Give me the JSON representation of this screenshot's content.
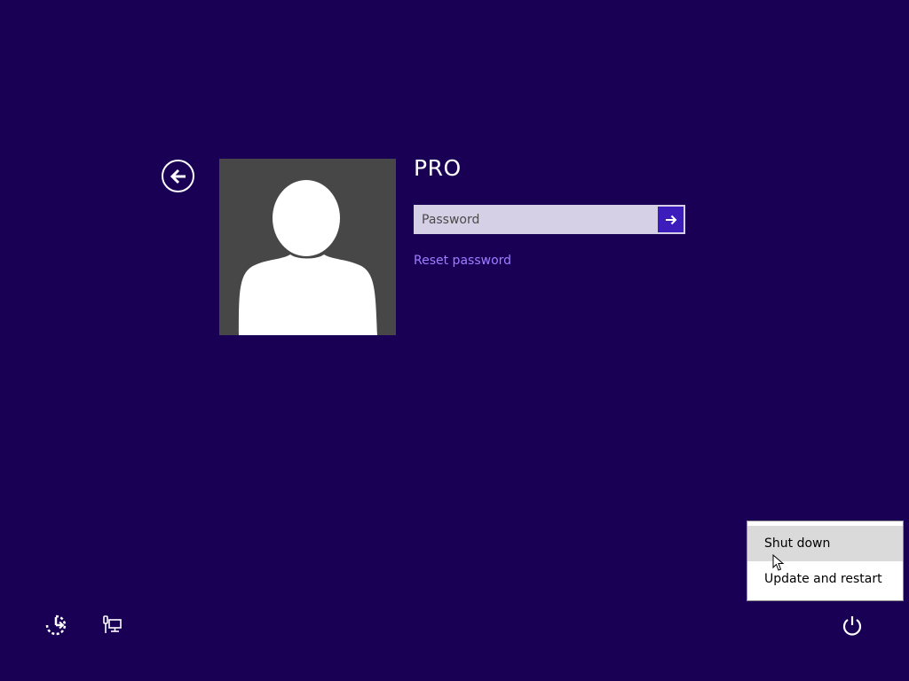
{
  "user": {
    "name": "PRO"
  },
  "login": {
    "password_placeholder": "Password",
    "password_value": "",
    "reset_password_label": "Reset password"
  },
  "power_menu": {
    "items": [
      {
        "label": "Shut down",
        "hovered": true
      },
      {
        "label": "Update and restart",
        "hovered": false
      }
    ]
  },
  "icons": {
    "back": "back-arrow-icon",
    "submit": "arrow-right-icon",
    "avatar": "user-silhouette-icon",
    "ease_of_access": "ease-of-access-icon",
    "network": "network-icon",
    "power": "power-icon",
    "cursor": "mouse-pointer-icon"
  },
  "colors": {
    "background": "#1a0055",
    "accent": "#3d1cbc",
    "link": "#a07cff",
    "input_background": "#d6d0e6",
    "avatar_background": "#474747",
    "menu_hover": "#dadada"
  }
}
